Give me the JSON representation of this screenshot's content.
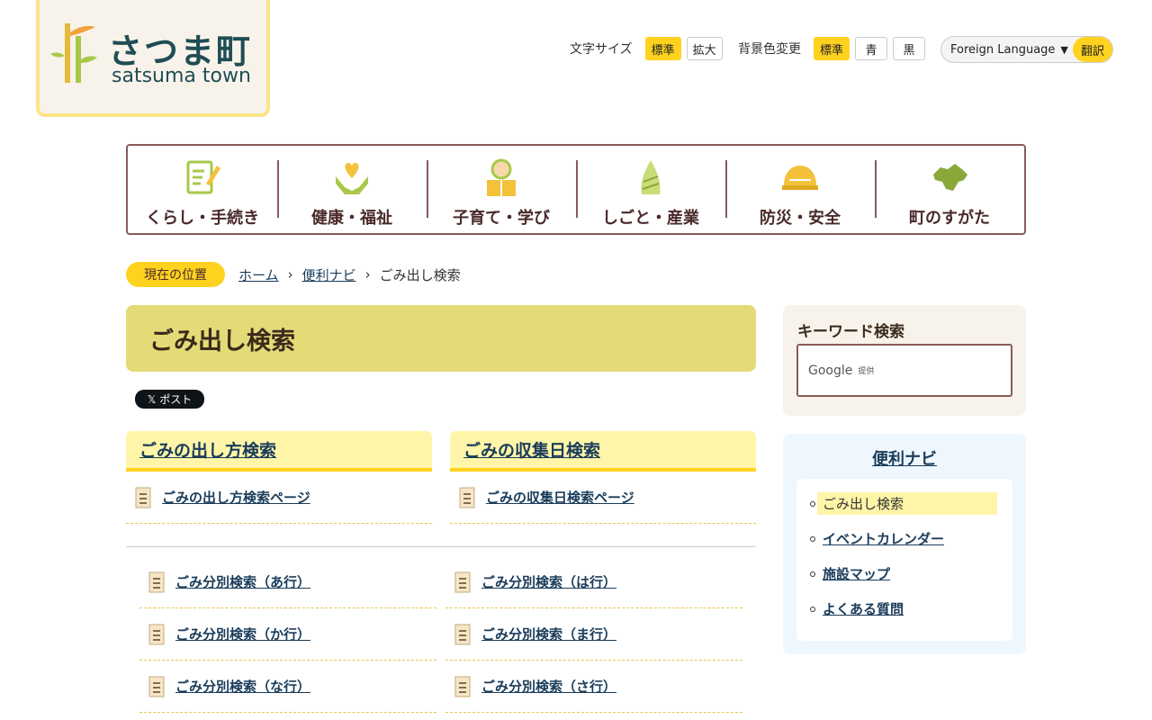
{
  "logo": {
    "jp": "さつま町",
    "en": "satsuma town"
  },
  "utility": {
    "font_size_label": "文字サイズ",
    "font_size_buttons": [
      "標準",
      "拡大"
    ],
    "bg_label": "背景色変更",
    "bg_buttons": [
      "標準",
      "青",
      "黒"
    ],
    "language_select": "Foreign Language",
    "translate_button": "翻訳"
  },
  "global_nav": [
    {
      "label": "くらし・手続き",
      "icon": "document-pen-icon"
    },
    {
      "label": "健康・福祉",
      "icon": "heart-hands-icon"
    },
    {
      "label": "子育て・学び",
      "icon": "child-book-icon"
    },
    {
      "label": "しごと・産業",
      "icon": "bamboo-shoot-icon"
    },
    {
      "label": "防災・安全",
      "icon": "helmet-icon"
    },
    {
      "label": "町のすがた",
      "icon": "town-map-icon"
    }
  ],
  "breadcrumb": {
    "label": "現在の位置",
    "items": [
      "ホーム",
      "便利ナビ"
    ],
    "current": "ごみ出し検索"
  },
  "page_title": "ごみ出し検索",
  "share": {
    "x_post": "𝕏 ポスト"
  },
  "sections": [
    {
      "heading": "ごみの出し方検索",
      "link": "ごみの出し方検索ページ"
    },
    {
      "heading": "ごみの収集日検索",
      "link": "ごみの収集日検索ページ"
    }
  ],
  "bunbetsu_left": [
    "ごみ分別検索（あ行）",
    "ごみ分別検索（か行）",
    "ごみ分別検索（な行）"
  ],
  "bunbetsu_right": [
    "ごみ分別検索（は行）",
    "ごみ分別検索（ま行）",
    "ごみ分別検索（さ行）"
  ],
  "keyword": {
    "title": "キーワード検索",
    "google": "Google",
    "provided": "提供"
  },
  "navi": {
    "title": "便利ナビ",
    "items": [
      "ごみ出し検索",
      "イベントカレンダー",
      "施設マップ",
      "よくある質問"
    ]
  },
  "colors": {
    "accent": "#ffd21f",
    "title_bg": "#e4db78",
    "link": "#1a3c5a",
    "nav_border": "#8a5a5a"
  }
}
